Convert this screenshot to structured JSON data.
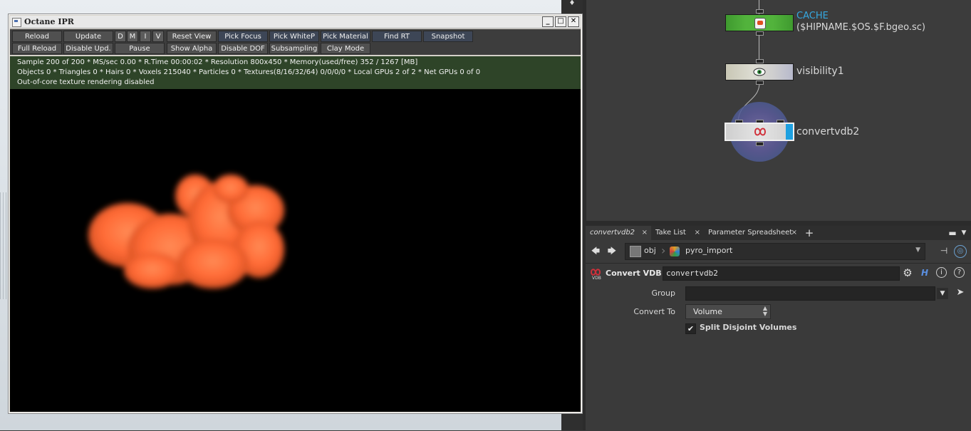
{
  "ipr": {
    "title": "Octane IPR",
    "window_buttons": [
      "_",
      "□",
      "✕"
    ],
    "toolbar_row1": [
      {
        "label": "Reload",
        "style": "normal"
      },
      {
        "label": "Update",
        "style": "normal"
      },
      {
        "label": "D",
        "style": "lt"
      },
      {
        "label": "M",
        "style": "lt"
      },
      {
        "label": "I",
        "style": "lt"
      },
      {
        "label": "V",
        "style": "lt"
      },
      {
        "label": "Reset View",
        "style": "normal"
      },
      {
        "label": "Pick Focus",
        "style": "blue"
      },
      {
        "label": "Pick WhiteP",
        "style": "blue"
      },
      {
        "label": "Pick Material",
        "style": "blue"
      },
      {
        "label": "Find RT",
        "style": "blue"
      },
      {
        "label": "Snapshot",
        "style": "blue"
      }
    ],
    "toolbar_row2": [
      {
        "label": "Full Reload"
      },
      {
        "label": "Disable Upd."
      },
      {
        "label": "Pause"
      },
      {
        "label": "Show Alpha"
      },
      {
        "label": "Disable DOF"
      },
      {
        "label": "Subsampling"
      },
      {
        "label": "Clay Mode"
      }
    ],
    "status_lines": [
      "Sample 200 of 200 * MS/sec 0.00 * R.Time 00:00:02 * Resolution 800x450 * Memory(used/free) 352 / 1267 [MB]",
      "Objects 0 * Triangles 0 * Hairs 0 * Voxels 215040 * Particles 0 * Textures(8/16/32/64) 0/0/0/0 * Local GPUs 2 of 2 * Net GPUs 0 of 0",
      "Out-of-core texture rendering disabled"
    ]
  },
  "network": {
    "nodes": [
      {
        "name": "CACHE",
        "sub": "($HIPNAME.$OS.$F.bgeo.sc)",
        "icon": "cache-icon"
      },
      {
        "name": "visibility1",
        "icon": "eye-icon"
      },
      {
        "name": "convertvdb2",
        "icon": "vdb-icon"
      }
    ]
  },
  "params": {
    "tabs": [
      {
        "label": "convertvdb2",
        "active": true
      },
      {
        "label": "Take List",
        "active": false
      },
      {
        "label": "Parameter Spreadsheet",
        "active": false
      }
    ],
    "path": {
      "root": "obj",
      "current": "pyro_import"
    },
    "node_type": "Convert VDB",
    "node_name": "convertvdb2",
    "group_label": "Group",
    "group_value": "",
    "convert_to_label": "Convert To",
    "convert_to_value": "Volume",
    "split_label": "Split Disjoint Volumes",
    "split_checked": true
  },
  "colors": {
    "status_bg": "#2e4428",
    "cache_color": "#35a8e0",
    "smoke": "#ff6a2e"
  }
}
